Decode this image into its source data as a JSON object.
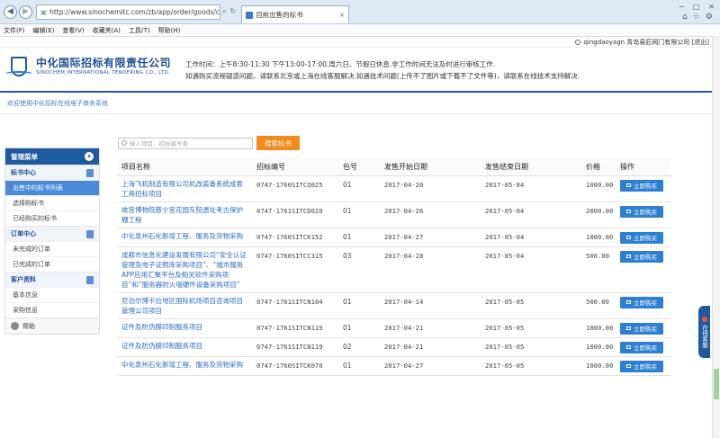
{
  "browser": {
    "url": "http://www.sinochemitc.com/zb/app/order/goods/ca",
    "tab_title": "目前出售的标书",
    "menu": [
      "文件(F)",
      "编辑(E)",
      "查看(V)",
      "收藏夹(A)",
      "工具(T)",
      "帮助(H)"
    ]
  },
  "userbar": {
    "text": "qingdaoyagn 青岛易匠网门有限公司 [退出]"
  },
  "header": {
    "company_cn": "中化国际招标有限责任公司",
    "company_en": "SINOCHEM INTERNATIONAL TENDERING CO., LTD.",
    "notice_line1": "工作时间：上午8:30-11:30 下午13:00-17:00.周六日、节假日休息.非工作时间无法及时进行审核工作.",
    "notice_line2": "如遇购买流程疑惑问题，请联系北京或上海在线客服解决.如遇技术问题(上传不了图片或下载不了文件等)，请联系在线技术支持解决."
  },
  "welcome": "欢迎使用中化招标在线电子商务系统",
  "sidebar": {
    "title": "管理菜单",
    "groups": [
      {
        "label": "标书中心",
        "items": [
          "出售中的标书列表",
          "选择购标书",
          "已经购买的标书"
        ]
      },
      {
        "label": "订单中心",
        "items": [
          "未完成的订单",
          "已完成的订单"
        ]
      },
      {
        "label": "客户资料",
        "items": [
          "基本信息",
          "采购信息"
        ]
      }
    ],
    "help": "帮助"
  },
  "search": {
    "placeholder": "输入项目、招标编号查",
    "button": "搜索标书"
  },
  "table": {
    "headers": [
      "项目名称",
      "招标编号",
      "包号",
      "发售开始日期",
      "发售结束日期",
      "价格",
      "操作"
    ],
    "buy_label": "立即购买",
    "rows": [
      {
        "name": "上海飞机制造有限公司机改装备系统成套工具招标项目",
        "code": "0747-1760SITCQ025",
        "pkg": "01",
        "start": "2017-04-20",
        "end": "2017-05-04",
        "price": "1000.00"
      },
      {
        "name": "故宫博物院慈宁宫花园东院遗址考古保护棚工程",
        "code": "0747-1761SITCD020",
        "pkg": "01",
        "start": "2017-04-26",
        "end": "2017-05-04",
        "price": "2000.00"
      },
      {
        "name": "中化泉州石化新增工程、服务及货物采购",
        "code": "0747-1760SITCK152",
        "pkg": "01",
        "start": "2017-04-27",
        "end": "2017-05-04",
        "price": "1000.00"
      },
      {
        "name": "成都市信息化建设发展有限公司“安全认证管理及电子证照库采购项目”、“城市服务APP应用汇聚平台及相关软件采购项目”和“服务器防火墙硬件设备采购项目”",
        "code": "0747-1760SITCC315",
        "pkg": "03",
        "start": "2017-04-28",
        "end": "2017-05-04",
        "price": "500.00"
      },
      {
        "name": "尼泊尔博卡拉地区国际机场项目咨询项目管理公司项目",
        "code": "0747-1761SITCN104",
        "pkg": "01",
        "start": "2017-04-14",
        "end": "2017-05-05",
        "price": "500.00"
      },
      {
        "name": "证件及防伪膜印制服务项目",
        "code": "0747-1761SITCN119",
        "pkg": "01",
        "start": "2017-04-21",
        "end": "2017-05-05",
        "price": "1000.00"
      },
      {
        "name": "证件及防伪膜印制服务项目",
        "code": "0747-1761SITCN119",
        "pkg": "02",
        "start": "2017-04-21",
        "end": "2017-05-05",
        "price": "1000.00"
      },
      {
        "name": "中化泉州石化新增工程、服务及货物采购",
        "code": "0747-1760SITCK070",
        "pkg": "01",
        "start": "2017-04-27",
        "end": "2017-05-05",
        "price": "1000.00"
      }
    ]
  },
  "float_service": "在线客服",
  "colors": {
    "brand": "#1f5a9e",
    "accent": "#f08b1d",
    "button": "#2c7fd3",
    "link": "#2a6cc0"
  }
}
